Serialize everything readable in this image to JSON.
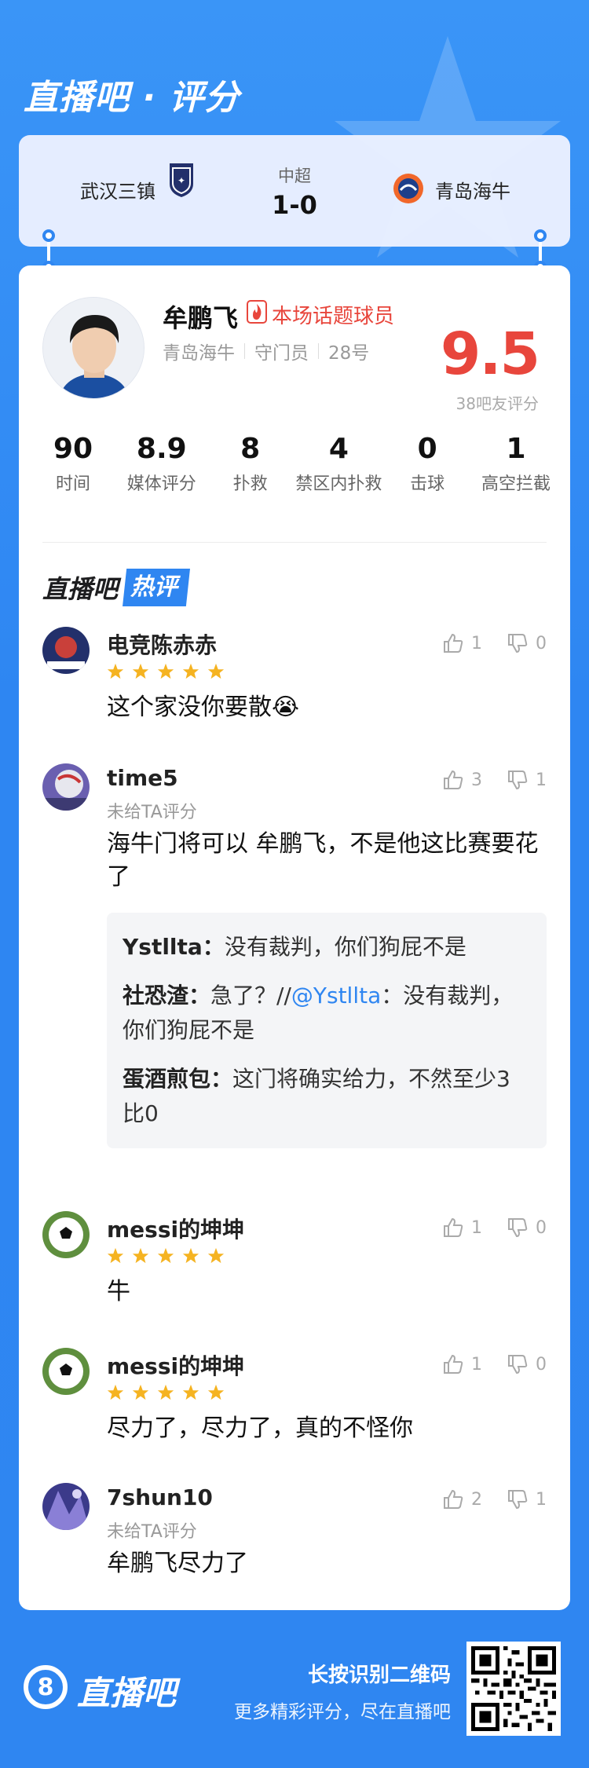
{
  "header": {
    "title": "直播吧 · 评分"
  },
  "match": {
    "home_team": "武汉三镇",
    "away_team": "青岛海牛",
    "league": "中超",
    "score": "1-0"
  },
  "player": {
    "name": "牟鹏飞",
    "tag": "本场话题球员",
    "team": "青岛海牛",
    "position": "守门员",
    "number": "28号",
    "rating": "9.5",
    "rating_label": "38吧友评分"
  },
  "stats": [
    {
      "value": "90",
      "label": "时间"
    },
    {
      "value": "8.9",
      "label": "媒体评分"
    },
    {
      "value": "8",
      "label": "扑救"
    },
    {
      "value": "4",
      "label": "禁区内扑救"
    },
    {
      "value": "0",
      "label": "击球"
    },
    {
      "value": "1",
      "label": "高空拦截"
    }
  ],
  "section": {
    "title_main": "直播吧",
    "title_tag": "热评"
  },
  "comments": [
    {
      "user": "电竞陈赤赤",
      "stars": 5,
      "unrated": "",
      "likes": "1",
      "dislikes": "0",
      "text": "这个家没你要散😭"
    },
    {
      "user": "time5",
      "stars": 0,
      "unrated": "未给TA评分",
      "likes": "3",
      "dislikes": "1",
      "text": "海牛门将可以 牟鹏飞，不是他这比赛要花了",
      "replies": [
        {
          "user": "Ystllta：",
          "pre": "",
          "mention": "",
          "text": "没有裁判，你们狗屁不是"
        },
        {
          "user": "社恐渣：",
          "pre": "急了？//",
          "mention": "@Ystllta",
          "text": "：没有裁判，你们狗屁不是"
        },
        {
          "user": "蛋酒煎包：",
          "pre": "",
          "mention": "",
          "text": "这门将确实给力，不然至少3比0"
        }
      ]
    },
    {
      "user": "messi的坤坤",
      "stars": 5,
      "unrated": "",
      "likes": "1",
      "dislikes": "0",
      "text": "牛"
    },
    {
      "user": "messi的坤坤",
      "stars": 5,
      "unrated": "",
      "likes": "1",
      "dislikes": "0",
      "text": "尽力了，尽力了，真的不怪你"
    },
    {
      "user": "7shun10",
      "stars": 0,
      "unrated": "未给TA评分",
      "likes": "2",
      "dislikes": "1",
      "text": "牟鹏飞尽力了"
    }
  ],
  "footer": {
    "logo_glyph": "8",
    "brand": "直播吧",
    "line1": "长按识别二维码",
    "line2": "更多精彩评分，尽在直播吧"
  },
  "colors": {
    "accent": "#2f86f1",
    "rating": "#e8463c",
    "star": "#f5b321"
  }
}
